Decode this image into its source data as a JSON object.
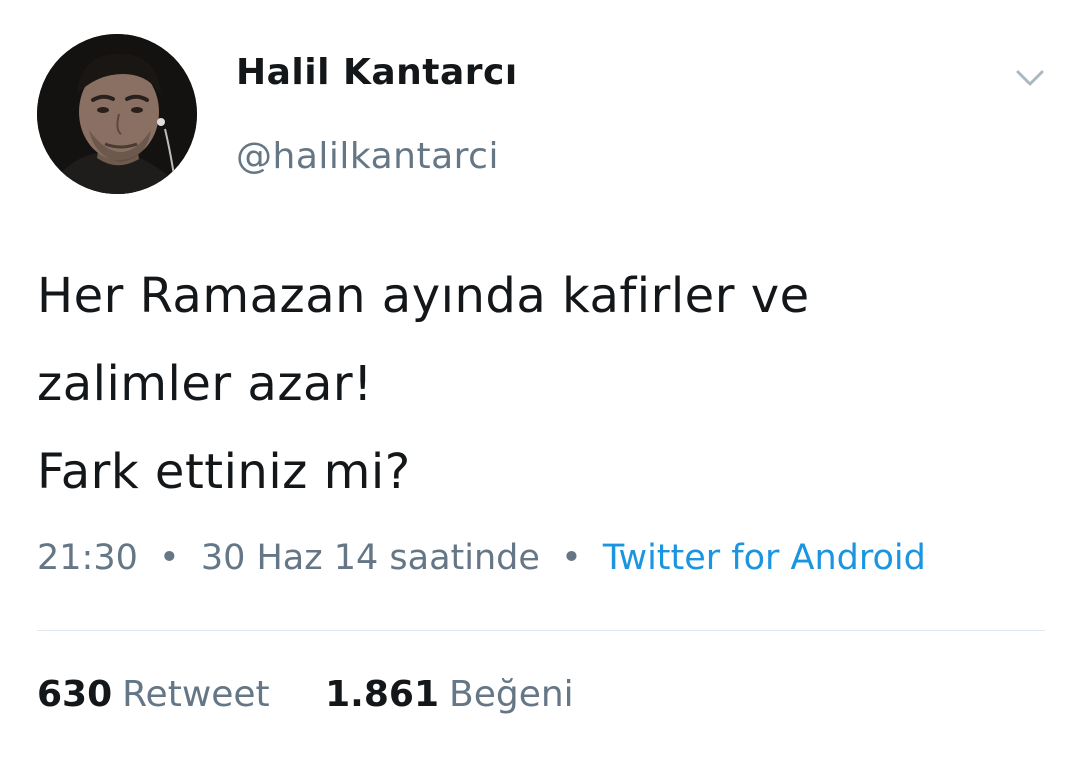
{
  "user": {
    "display_name": "Halil Kantarcı",
    "handle": "@halilkantarci"
  },
  "tweet": {
    "lines": [
      "Her Ramazan ayında kafirler ve",
      "zalimler azar!",
      "Fark ettiniz mi?"
    ]
  },
  "meta": {
    "time": "21:30",
    "date": "30 Haz 14 saatinde",
    "separator": "•",
    "source": "Twitter for Android"
  },
  "stats": {
    "retweets_count": "630",
    "retweets_label": "Retweet",
    "likes_count": "1.861",
    "likes_label": "Beğeni"
  },
  "icons": {
    "menu": "chevron-down-icon"
  },
  "colors": {
    "primary_text": "#14171a",
    "secondary_text": "#657786",
    "link": "#1b95e0",
    "divider": "#e1e8ed"
  }
}
